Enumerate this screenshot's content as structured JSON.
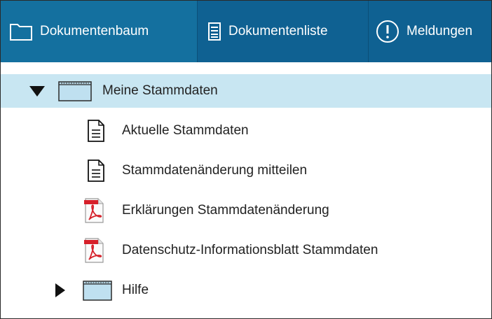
{
  "tabs": [
    {
      "label": "Dokumentenbaum",
      "icon": "folder-outline-icon"
    },
    {
      "label": "Dokumentenliste",
      "icon": "list-document-icon"
    },
    {
      "label": "Meldungen",
      "icon": "exclamation-circle-icon"
    }
  ],
  "tree": {
    "folder_main": {
      "label": "Meine Stammdaten",
      "expanded": true
    },
    "items": [
      {
        "label": "Aktuelle Stammdaten",
        "icon": "document-icon"
      },
      {
        "label": "Stammdatenänderung mitteilen",
        "icon": "document-icon"
      },
      {
        "label": "Erklärungen Stammdatenänderung",
        "icon": "pdf-icon"
      },
      {
        "label": "Datenschutz-Informationsblatt Stammdaten",
        "icon": "pdf-icon"
      }
    ],
    "folder_help": {
      "label": "Hilfe",
      "expanded": false
    }
  },
  "colors": {
    "tab_bar": "#12689c",
    "selected_row": "#c8e6f2",
    "folder_fill": "#bfe0f0",
    "pdf_red": "#d6202a"
  }
}
